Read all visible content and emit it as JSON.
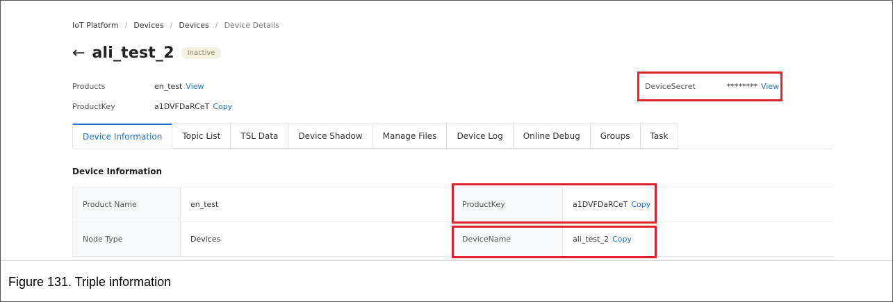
{
  "breadcrumb": [
    "IoT Platform",
    "Devices",
    "Devices",
    "Device Details"
  ],
  "breadcrumb_separator": "/",
  "header": {
    "back_icon": "arrow-left-icon",
    "title": "ali_test_2",
    "status": "Inactive"
  },
  "meta": {
    "products_label": "Products",
    "products_value": "en_test",
    "products_link": "View",
    "productkey_label": "ProductKey",
    "productkey_value": "a1DVFDaRCeT",
    "productkey_link": "Copy",
    "devicesecret_label": "DeviceSecret",
    "devicesecret_value": "********",
    "devicesecret_link": "View"
  },
  "tabs": [
    {
      "label": "Device Information",
      "active": true
    },
    {
      "label": "Topic List"
    },
    {
      "label": "TSL Data"
    },
    {
      "label": "Device Shadow"
    },
    {
      "label": "Manage Files"
    },
    {
      "label": "Device Log"
    },
    {
      "label": "Online Debug"
    },
    {
      "label": "Groups"
    },
    {
      "label": "Task"
    }
  ],
  "section_title": "Device Information",
  "info_rows": [
    {
      "k1": "Product Name",
      "v1": "en_test",
      "k2": "ProductKey",
      "v2": "a1DVFDaRCeT",
      "link2": "Copy"
    },
    {
      "k1": "Node Type",
      "v1": "Devices",
      "k2": "DeviceName",
      "v2": "ali_test_2",
      "link2": "Copy"
    }
  ],
  "caption": "Figure 131.  Triple information",
  "colors": {
    "accent": "#1f6fd1",
    "highlight": "#e0212a",
    "badge_bg": "#f3f1df"
  }
}
